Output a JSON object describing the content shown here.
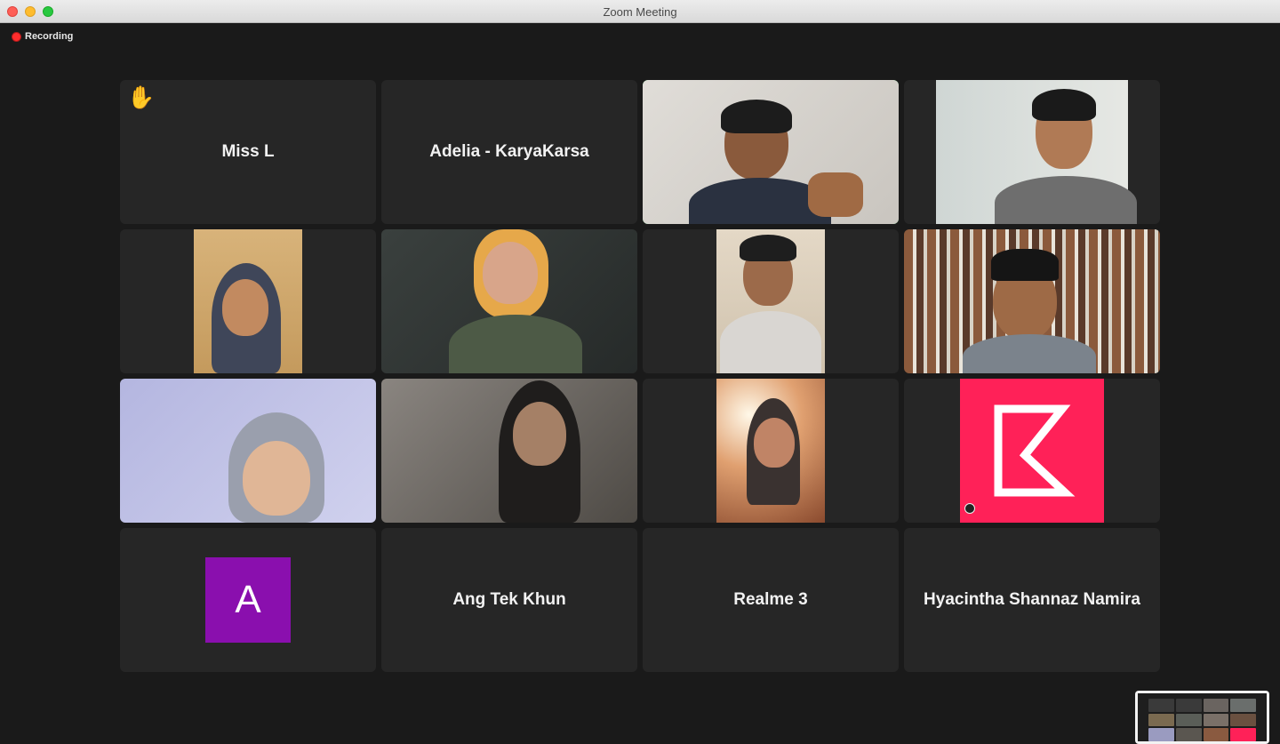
{
  "window": {
    "title": "Zoom Meeting"
  },
  "status": {
    "recording_label": "Recording"
  },
  "participants": [
    {
      "name": "Miss L",
      "video": false,
      "hand_raised": true
    },
    {
      "name": "Adelia - KaryaKarsa",
      "video": false
    },
    {
      "video": true,
      "active_speaker": true
    },
    {
      "video": true
    },
    {
      "video": true
    },
    {
      "video": true
    },
    {
      "video": true
    },
    {
      "video": true
    },
    {
      "video": true
    },
    {
      "video": true
    },
    {
      "video": true
    },
    {
      "video": true,
      "logo": "karyakarsa-k-logo"
    },
    {
      "video": false,
      "avatar_letter": "A"
    },
    {
      "name": "Ang Tek Khun",
      "video": false
    },
    {
      "name": "Realme 3",
      "video": false
    },
    {
      "name": "Hyacintha Shannaz Namira",
      "video": false
    }
  ],
  "colors": {
    "active_speaker_border": "#23d959",
    "recording_dot": "#ff2d2d",
    "karyakarsa_brand": "#ff2158",
    "avatar_a_bg": "#8a0fae"
  },
  "icons": {
    "hand": "raised-hand-icon",
    "recording": "recording-dot-icon"
  }
}
